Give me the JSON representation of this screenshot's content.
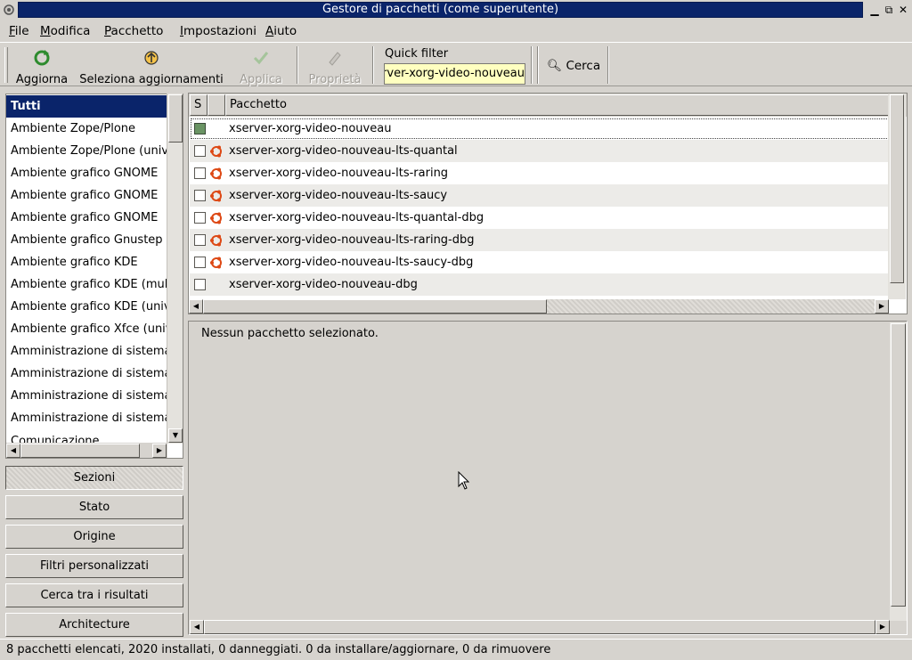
{
  "window": {
    "title": "Gestore di pacchetti  (come superutente)"
  },
  "menu": [
    "File",
    "Modifica",
    "Pacchetto",
    "Impostazioni",
    "Aiuto"
  ],
  "toolbar": {
    "reload": "Aggiorna",
    "mark_upgrades": "Seleziona aggiornamenti",
    "apply": "Applica",
    "properties": "Proprietà",
    "quick_filter_label": "Quick filter",
    "quick_filter_value": "xserver-xorg-video-nouveau",
    "search": "Cerca"
  },
  "sections": [
    "Tutti",
    "Ambiente Zope/Plone",
    "Ambiente Zope/Plone (universe)",
    "Ambiente grafico GNOME",
    "Ambiente grafico GNOME",
    "Ambiente grafico GNOME",
    "Ambiente grafico Gnustep",
    "Ambiente grafico KDE",
    "Ambiente grafico KDE (multiverse)",
    "Ambiente grafico KDE (universe)",
    "Ambiente grafico Xfce (universe)",
    "Amministrazione di sistema",
    "Amministrazione di sistema",
    "Amministrazione di sistema",
    "Amministrazione di sistema",
    "Comunicazione"
  ],
  "filter_buttons": [
    "Sezioni",
    "Stato",
    "Origine",
    "Filtri personalizzati",
    "Cerca tra i risultati",
    "Architecture"
  ],
  "table": {
    "col_status": "S",
    "col_package": "Pacchetto",
    "rows": [
      {
        "name": "xserver-xorg-video-nouveau",
        "installed": true,
        "ubuntu": false
      },
      {
        "name": "xserver-xorg-video-nouveau-lts-quantal",
        "installed": false,
        "ubuntu": true
      },
      {
        "name": "xserver-xorg-video-nouveau-lts-raring",
        "installed": false,
        "ubuntu": true
      },
      {
        "name": "xserver-xorg-video-nouveau-lts-saucy",
        "installed": false,
        "ubuntu": true
      },
      {
        "name": "xserver-xorg-video-nouveau-lts-quantal-dbg",
        "installed": false,
        "ubuntu": true
      },
      {
        "name": "xserver-xorg-video-nouveau-lts-raring-dbg",
        "installed": false,
        "ubuntu": true
      },
      {
        "name": "xserver-xorg-video-nouveau-lts-saucy-dbg",
        "installed": false,
        "ubuntu": true
      },
      {
        "name": "xserver-xorg-video-nouveau-dbg",
        "installed": false,
        "ubuntu": false
      }
    ]
  },
  "details": {
    "text": "Nessun pacchetto selezionato."
  },
  "status": {
    "text": "8 pacchetti elencati, 2020 installati, 0 danneggiati. 0 da installare/aggiornare, 0 da rimuovere"
  },
  "colors": {
    "selection": "#0a246a",
    "quick_filter_bg": "#ffffc0",
    "installed": "#6a9464",
    "ubuntu": "#dd4814"
  }
}
